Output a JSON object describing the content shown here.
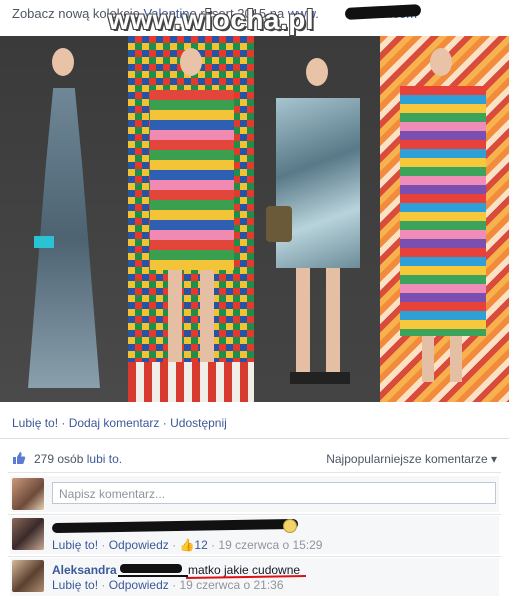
{
  "post": {
    "text_prefix": "Zobacz nową kolekcję ",
    "brand_link": "Valentino",
    "text_middle": " resort 2015 na ",
    "url_prefix": "www.",
    "url_suffix": ".com"
  },
  "watermark": "www.wiocha.pl",
  "actions": {
    "like": "Lubię to!",
    "comment": "Dodaj komentarz",
    "share": "Udostępnij",
    "separator": " · "
  },
  "likes": {
    "count_text": "279 osób",
    "suffix": " lubi to.",
    "sort_label": "Najpopularniejsze komentarze ▾"
  },
  "comment_input": {
    "placeholder": "Napisz komentarz..."
  },
  "comments": [
    {
      "like_label": "Lubię to!",
      "reply_label": "Odpowiedz",
      "like_count": "12",
      "timestamp": "19 czerwca o 15:29"
    },
    {
      "author": "Aleksandra",
      "text": "matko jakie cudowne",
      "like_label": "Lubię to!",
      "reply_label": "Odpowiedz",
      "timestamp": "19 czerwca o 21:36"
    }
  ],
  "colors": {
    "link": "#3b5998",
    "meta": "#90949c",
    "underline": "#dd1111"
  }
}
